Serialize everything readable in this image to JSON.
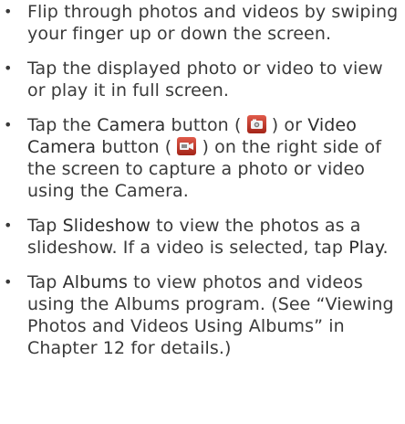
{
  "bullets": [
    {
      "text": "Flip through photos and videos by swiping your finger up or down the screen."
    },
    {
      "text": "Tap the displayed photo or video to view or play it in full screen."
    },
    {
      "pre": "Tap the ",
      "camera_label": "Camera",
      "mid1": " button ( ",
      "camera_icon": "camera-icon",
      "mid2": " ) or ",
      "video_camera_label": "Video Camera",
      "mid3": " button ( ",
      "video_icon": "video-camera-icon",
      "post": " ) on the right side of the screen to capture a photo or video using the Camera."
    },
    {
      "pre": "Tap ",
      "slideshow_label": "Slideshow",
      "mid": " to view the photos as a slideshow. If a video is selected, tap ",
      "play_label": "Play",
      "post": "."
    },
    {
      "pre": "Tap ",
      "albums_label": "Albums",
      "post": " to view photos and videos using the Albums program. (See “Viewing Photos and Videos Using Albums” in Chapter 12 for details.)"
    }
  ],
  "bullet_glyph": "•",
  "colors": {
    "text": "#3a3a3a",
    "icon_bg": "#c0392b"
  }
}
